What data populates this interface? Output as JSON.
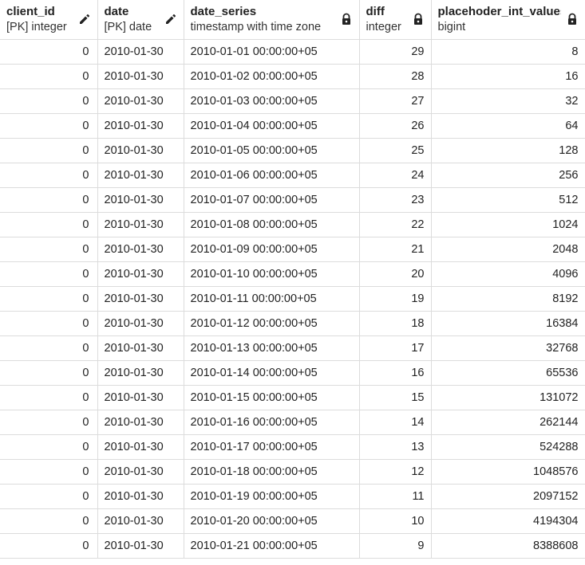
{
  "columns": [
    {
      "name": "client_id",
      "type": "[PK] integer",
      "icon": "pencil-icon",
      "align": "right"
    },
    {
      "name": "date",
      "type": "[PK] date",
      "icon": "pencil-icon",
      "align": "left"
    },
    {
      "name": "date_series",
      "type": "timestamp with time zone",
      "icon": "lock-icon",
      "align": "left"
    },
    {
      "name": "diff",
      "type": "integer",
      "icon": "lock-icon",
      "align": "right"
    },
    {
      "name": "placehoder_int_values",
      "type": "bigint",
      "icon": "lock-icon",
      "align": "right"
    }
  ],
  "rows": [
    [
      "0",
      "2010-01-30",
      "2010-01-01 00:00:00+05",
      "29",
      "8"
    ],
    [
      "0",
      "2010-01-30",
      "2010-01-02 00:00:00+05",
      "28",
      "16"
    ],
    [
      "0",
      "2010-01-30",
      "2010-01-03 00:00:00+05",
      "27",
      "32"
    ],
    [
      "0",
      "2010-01-30",
      "2010-01-04 00:00:00+05",
      "26",
      "64"
    ],
    [
      "0",
      "2010-01-30",
      "2010-01-05 00:00:00+05",
      "25",
      "128"
    ],
    [
      "0",
      "2010-01-30",
      "2010-01-06 00:00:00+05",
      "24",
      "256"
    ],
    [
      "0",
      "2010-01-30",
      "2010-01-07 00:00:00+05",
      "23",
      "512"
    ],
    [
      "0",
      "2010-01-30",
      "2010-01-08 00:00:00+05",
      "22",
      "1024"
    ],
    [
      "0",
      "2010-01-30",
      "2010-01-09 00:00:00+05",
      "21",
      "2048"
    ],
    [
      "0",
      "2010-01-30",
      "2010-01-10 00:00:00+05",
      "20",
      "4096"
    ],
    [
      "0",
      "2010-01-30",
      "2010-01-11 00:00:00+05",
      "19",
      "8192"
    ],
    [
      "0",
      "2010-01-30",
      "2010-01-12 00:00:00+05",
      "18",
      "16384"
    ],
    [
      "0",
      "2010-01-30",
      "2010-01-13 00:00:00+05",
      "17",
      "32768"
    ],
    [
      "0",
      "2010-01-30",
      "2010-01-14 00:00:00+05",
      "16",
      "65536"
    ],
    [
      "0",
      "2010-01-30",
      "2010-01-15 00:00:00+05",
      "15",
      "131072"
    ],
    [
      "0",
      "2010-01-30",
      "2010-01-16 00:00:00+05",
      "14",
      "262144"
    ],
    [
      "0",
      "2010-01-30",
      "2010-01-17 00:00:00+05",
      "13",
      "524288"
    ],
    [
      "0",
      "2010-01-30",
      "2010-01-18 00:00:00+05",
      "12",
      "1048576"
    ],
    [
      "0",
      "2010-01-30",
      "2010-01-19 00:00:00+05",
      "11",
      "2097152"
    ],
    [
      "0",
      "2010-01-30",
      "2010-01-20 00:00:00+05",
      "10",
      "4194304"
    ],
    [
      "0",
      "2010-01-30",
      "2010-01-21 00:00:00+05",
      "9",
      "8388608"
    ]
  ]
}
